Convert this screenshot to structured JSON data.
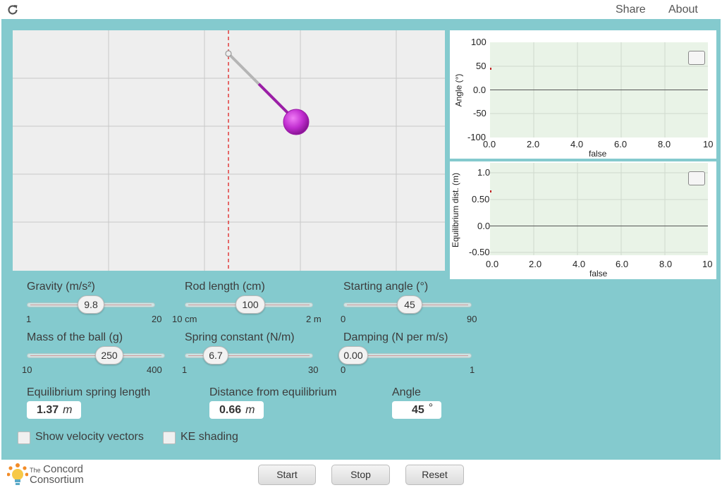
{
  "topbar": {
    "share_label": "Share",
    "about_label": "About"
  },
  "graph1": {
    "y_title": "Angle (°)",
    "x_title": "false",
    "y_ticks": [
      "100",
      "50",
      "0.0",
      "-50",
      "-100"
    ],
    "x_ticks": [
      "0.0",
      "2.0",
      "4.0",
      "6.0",
      "8.0",
      "10"
    ]
  },
  "graph2": {
    "y_title": "Equilibrium dist. (m)",
    "x_title": "false",
    "y_ticks": [
      "1.0",
      "0.50",
      "0.0",
      "-0.50"
    ],
    "x_ticks": [
      "0.0",
      "2.0",
      "4.0",
      "6.0",
      "8.0",
      "10"
    ]
  },
  "controls": {
    "gravity": {
      "label": "Gravity (m/s²)",
      "value": "9.8",
      "min": "1",
      "max": "20"
    },
    "rod_length": {
      "label": "Rod length (cm)",
      "value": "100",
      "min": "10 cm",
      "max": "2 m"
    },
    "starting_angle": {
      "label": "Starting angle (°)",
      "value": "45",
      "min": "0",
      "max": "90"
    },
    "mass": {
      "label": "Mass of the ball (g)",
      "value": "250",
      "min": "10",
      "max": "400"
    },
    "spring_constant": {
      "label": "Spring constant (N/m)",
      "value": "6.7",
      "min": "1",
      "max": "30"
    },
    "damping": {
      "label": "Damping (N per m/s)",
      "value": "0.00",
      "min": "0",
      "max": "1"
    }
  },
  "readouts": {
    "equilibrium_length": {
      "label": "Equilibrium spring length",
      "value": "1.37",
      "unit": "m"
    },
    "distance": {
      "label": "Distance from equilibrium",
      "value": "0.66",
      "unit": "m"
    },
    "angle": {
      "label": "Angle",
      "value": "45",
      "unit": "°"
    }
  },
  "checkboxes": {
    "velocity_label": "Show velocity vectors",
    "ke_label": "KE shading"
  },
  "buttons": {
    "start": "Start",
    "stop": "Stop",
    "reset": "Reset"
  },
  "brand": {
    "line1_small": "The",
    "line1_big": "Concord",
    "line2": "Consortium"
  },
  "colors": {
    "panel_bg": "#84cace",
    "ball": "#b422c4",
    "rod_spring": "#9b1fa6",
    "equilibrium_line": "#e02020"
  }
}
